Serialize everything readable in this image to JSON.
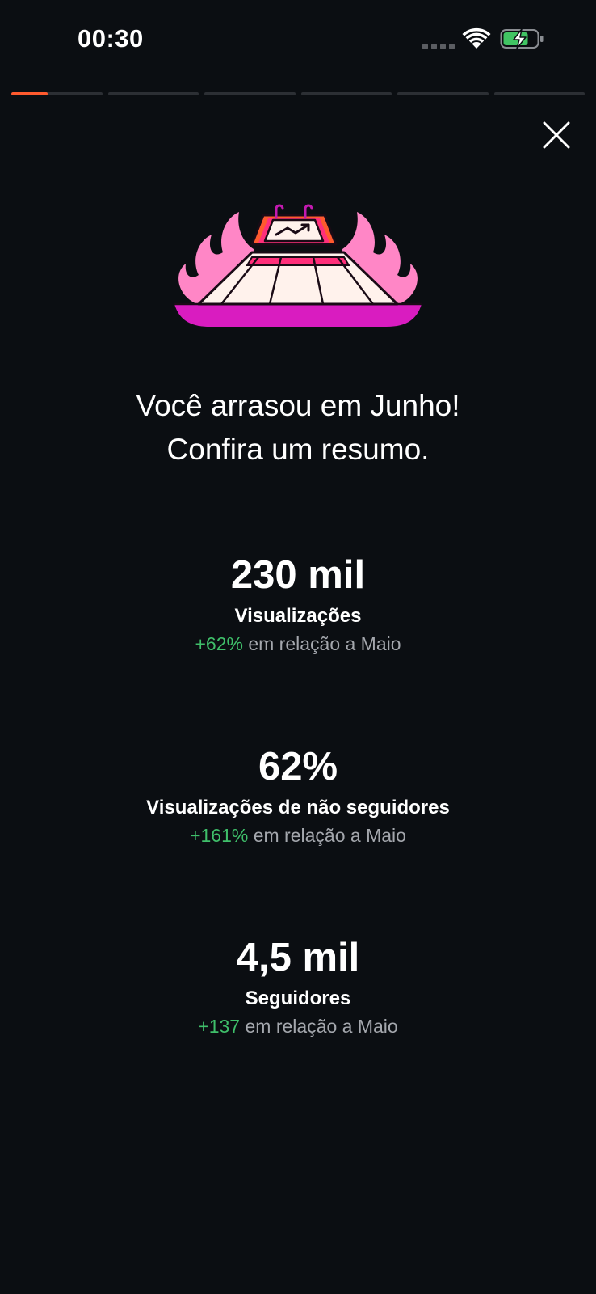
{
  "status_bar": {
    "time": "00:30",
    "battery_charging": true
  },
  "story": {
    "segments": 6,
    "current_segment_progress": 0.4,
    "accent_color": "#ff5a2e"
  },
  "close_icon": "close-icon",
  "illustration_icon": "flaming-chart-calendar-illustration",
  "headline": {
    "line1": "Você arrasou em Junho!",
    "line2": "Confira um resumo."
  },
  "stats": [
    {
      "value": "230 mil",
      "label": "Visualizações",
      "delta": "+62%",
      "comparison": "em relação a Maio"
    },
    {
      "value": "62%",
      "label": "Visualizações de não seguidores",
      "delta": "+161%",
      "comparison": "em relação a Maio"
    },
    {
      "value": "4,5 mil",
      "label": "Seguidores",
      "delta": "+137",
      "comparison": "em relação a Maio"
    }
  ],
  "colors": {
    "background": "#0b0e12",
    "positive_delta": "#3fbf6a",
    "muted_text": "#a4a7ad"
  }
}
